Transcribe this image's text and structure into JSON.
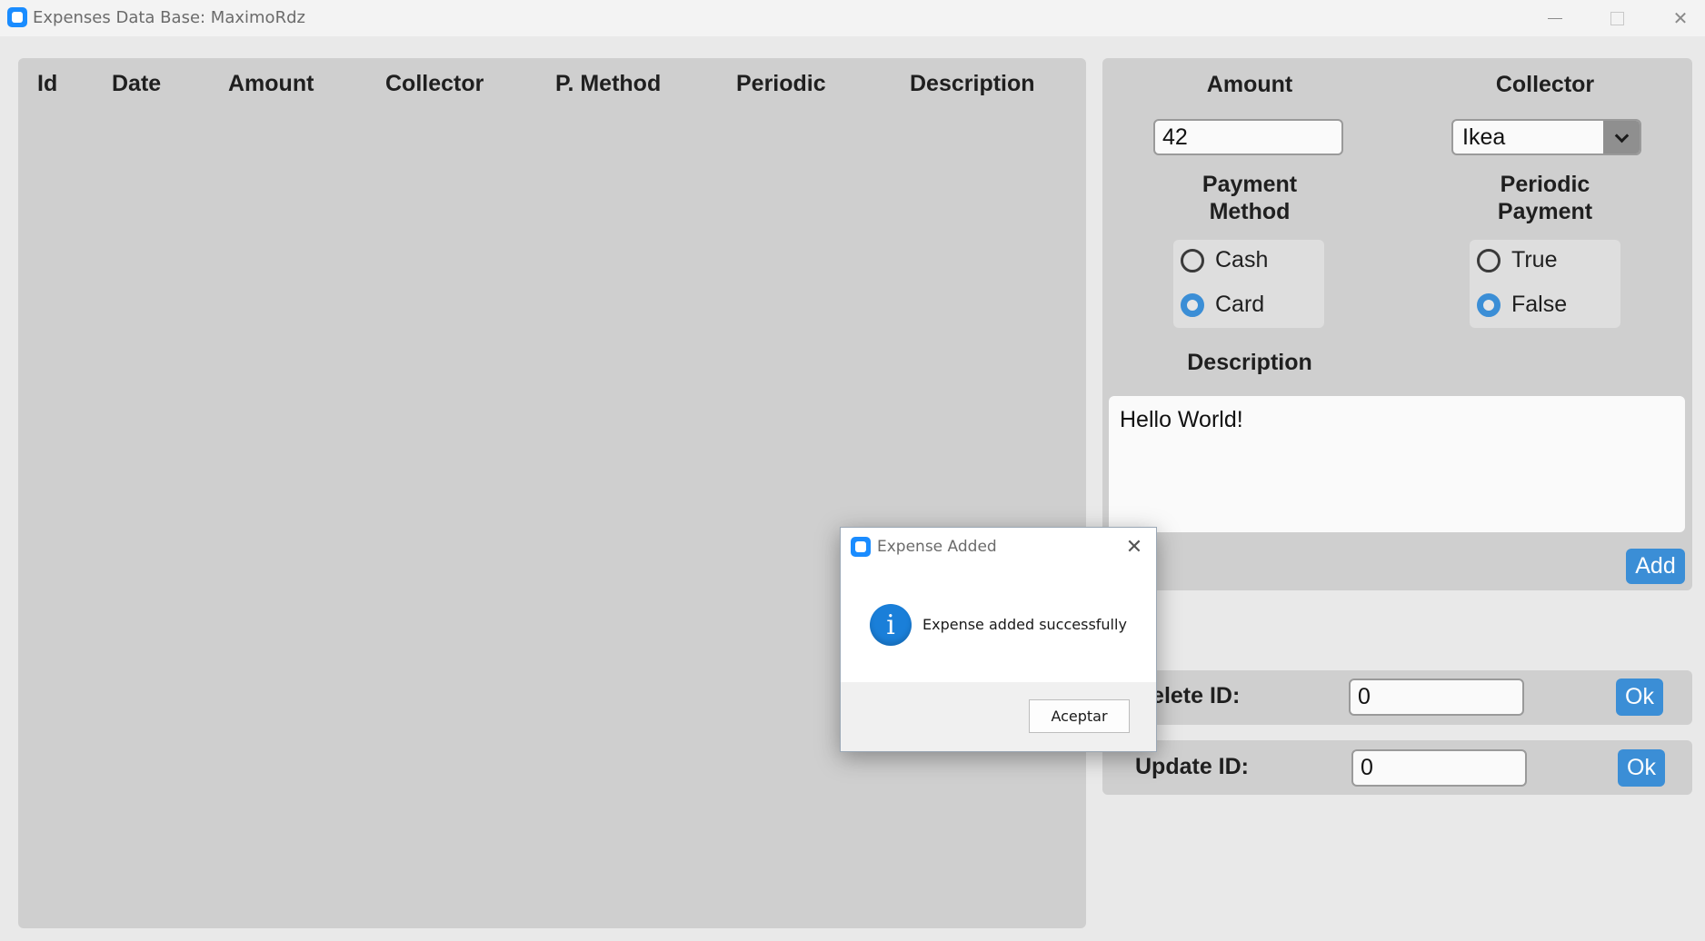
{
  "window": {
    "title": "Expenses Data Base: MaximoRdz",
    "icon": "app-icon"
  },
  "table": {
    "columns": [
      "Id",
      "Date",
      "Amount",
      "Collector",
      "P. Method",
      "Periodic",
      "Description"
    ],
    "rows": []
  },
  "form": {
    "amount_label": "Amount",
    "amount_value": "42",
    "collector_label": "Collector",
    "collector_value": "Ikea",
    "payment_method_label_1": "Payment",
    "payment_method_label_2": "Method",
    "payment_options": [
      {
        "label": "Cash",
        "checked": false
      },
      {
        "label": "Card",
        "checked": true
      }
    ],
    "periodic_label_1": "Periodic",
    "periodic_label_2": "Payment",
    "periodic_options": [
      {
        "label": "True",
        "checked": false
      },
      {
        "label": "False",
        "checked": true
      }
    ],
    "description_label": "Description",
    "description_value": "Hello World!",
    "add_label": "Add"
  },
  "delete": {
    "label": "Delete ID:",
    "value": "0",
    "ok_label": "Ok"
  },
  "update": {
    "label": "Update ID:",
    "value": "0",
    "ok_label": "Ok"
  },
  "dialog": {
    "title": "Expense Added",
    "message": "Expense added successfully",
    "ok_label": "Aceptar",
    "icon": "info-icon"
  },
  "colors": {
    "accent": "#3b8ed6",
    "panel": "#cfcfcf",
    "app_icon": "#1a8cff"
  }
}
